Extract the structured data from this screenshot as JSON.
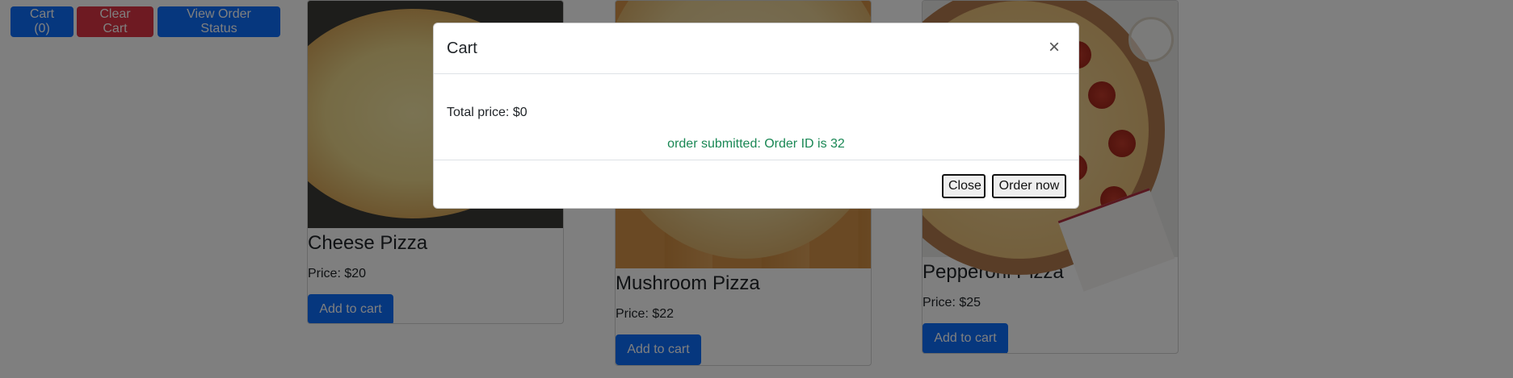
{
  "toolbar": {
    "cart_label": "Cart (0)",
    "clear_label": "Clear Cart",
    "status_label": "View Order Status"
  },
  "products": [
    {
      "name": "Cheese Pizza",
      "price": "Price: $20",
      "add_label": "Add to cart"
    },
    {
      "name": "Mushroom Pizza",
      "price": "Price: $22",
      "add_label": "Add to cart"
    },
    {
      "name": "Pepperoni Pizza",
      "price": "Price: $25",
      "add_label": "Add to cart"
    }
  ],
  "modal": {
    "title": "Cart",
    "close_icon": "×",
    "total_text": "Total price: $0",
    "order_message": "order submitted: Order ID is 32",
    "close_label": "Close",
    "order_label": "Order now"
  },
  "colors": {
    "primary": "#0d6efd",
    "danger": "#dc3545",
    "success": "#198754",
    "backdrop": "rgba(0,0,0,0.5)"
  }
}
